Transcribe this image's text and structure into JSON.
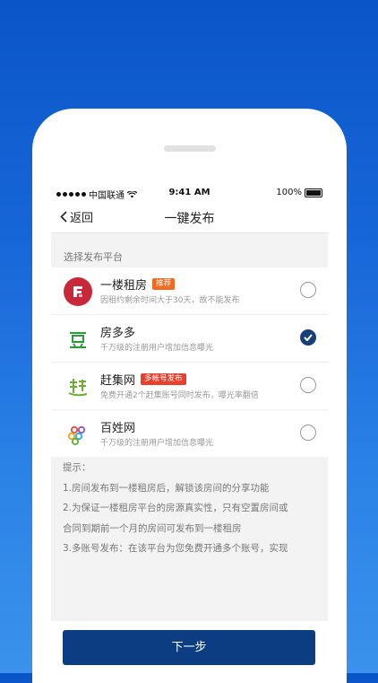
{
  "status_bar": {
    "carrier": "中国联通",
    "time": "9:41 AM",
    "battery": "100%"
  },
  "nav": {
    "back_label": "返回",
    "title": "一键发布"
  },
  "section_label": "选择发布平台",
  "platforms": [
    {
      "name": "一楼租房",
      "tag": "推荐",
      "desc": "因租约剩余时间大于30天，故不能发布",
      "selected": false,
      "icon": "yilou-logo-icon"
    },
    {
      "name": "房多多",
      "tag": "",
      "desc": "千万级的注册用户增加信息曝光",
      "selected": true,
      "icon": "fangduoduo-logo-icon"
    },
    {
      "name": "赶集网",
      "tag": "多帐号发布",
      "desc": "免费开通2个赶集账号同时发布，曝光率翻倍",
      "selected": false,
      "icon": "ganji-logo-icon"
    },
    {
      "name": "百姓网",
      "tag": "",
      "desc": "千万级的注册用户增加信息曝光",
      "selected": false,
      "icon": "baixing-logo-icon"
    }
  ],
  "tips": {
    "title": "提示：",
    "lines": [
      "1.房间发布到一楼租房后，解锁该房间的分享功能",
      "2.为保证一楼租房平台的房源真实性，只有空置房间或",
      "合同到期前一个月的房间可发布到一楼租房",
      "3.多账号发布：在该平台为您免费开通多个账号，实现"
    ]
  },
  "next_button": "下一步",
  "colors": {
    "primary": "#0c3d82",
    "tag_orange": "#f26a1f",
    "tag_red": "#e8402c",
    "background_blue": "#1766d8"
  }
}
